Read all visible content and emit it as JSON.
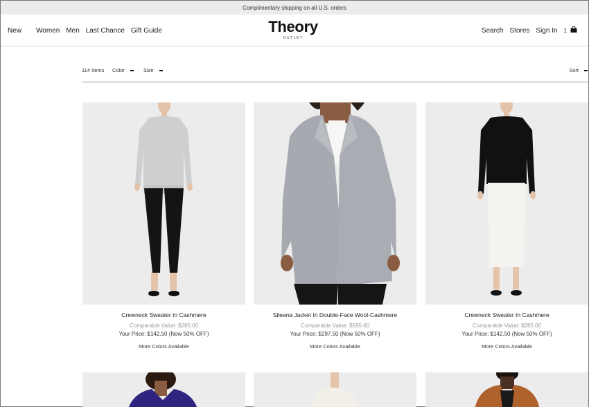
{
  "promo": {
    "text": "Complimentary shipping on all U.S. orders"
  },
  "nav": {
    "left": [
      "New",
      "Women",
      "Men",
      "Last Chance",
      "Gift Guide"
    ],
    "right": {
      "search": "Search",
      "stores": "Stores",
      "sign_in": "Sign In",
      "bag_count": "1"
    }
  },
  "logo": {
    "main": "Theory",
    "sub": "OUTLET"
  },
  "filters": {
    "count": "114 Items",
    "color": "Color",
    "size": "Size",
    "sort": "Sort"
  },
  "products": [
    {
      "name": "Crewneck Sweater In Cashmere",
      "comparable": "Comparable Value: $285.00",
      "price": "Your Price: $142.50 (Now 50% OFF)",
      "more": "More Colors Available"
    },
    {
      "name": "Sileena Jacket In Double-Face Wool-Cashmere",
      "comparable": "Comparable Value: $595.00",
      "price": "Your Price: $297.50 (Now 50% OFF)",
      "more": "More Colors Available"
    },
    {
      "name": "Crewneck Sweater In Cashmere",
      "comparable": "Comparable Value: $285.00",
      "price": "Your Price: $142.50 (Now 50% OFF)",
      "more": "More Colors Available"
    }
  ],
  "colors": {
    "image_bg": "#ececec",
    "promo_bg": "#ececec"
  },
  "icons": {
    "bag": "shopping-bag-icon"
  }
}
